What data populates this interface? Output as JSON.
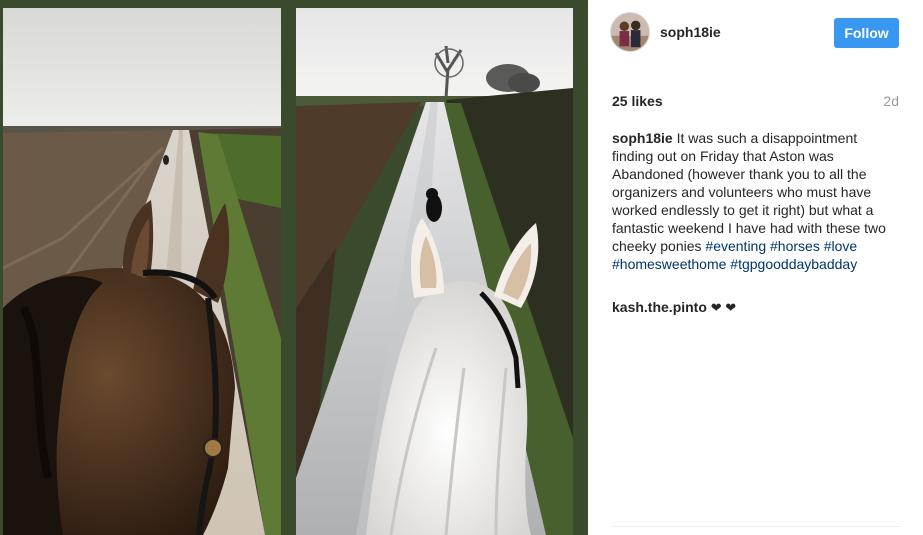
{
  "post": {
    "username": "soph18ie",
    "follow_label": "Follow",
    "likes": "25 likes",
    "age": "2d"
  },
  "caption": {
    "username": "soph18ie",
    "text": "It was such a disappointment finding out on Friday that Aston was Abandoned (however thank you to all the organizers and volunteers who must have worked endlessly to get it right) but what a fantastic weekend I have had with these two cheeky ponies",
    "tags": [
      "#eventing",
      "#horses",
      "#love",
      "#homesweethome",
      "#tgpgooddaybadday"
    ]
  },
  "comments": [
    {
      "username": "kash.the.pinto",
      "text": "❤ ❤"
    }
  ],
  "colors": {
    "follow_button": "#3897f0",
    "hashtag": "#003569",
    "photo_border": "#3a4a2c"
  },
  "icons": {
    "avatar": "profile-photo"
  }
}
